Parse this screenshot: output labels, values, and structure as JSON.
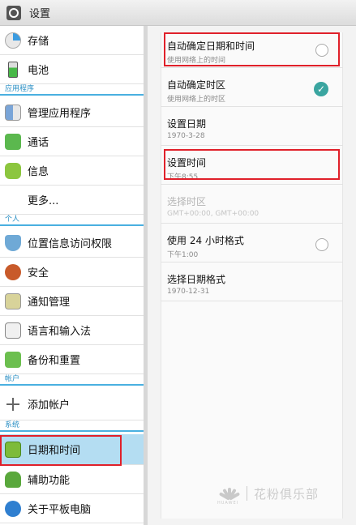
{
  "title": "设置",
  "sidebar": {
    "items": [
      {
        "label": "存储",
        "icon": "storage-pie-icon"
      },
      {
        "label": "电池",
        "icon": "battery-icon"
      },
      {
        "label": "管理应用程序",
        "icon": "apps-grid-icon"
      },
      {
        "label": "通话",
        "icon": "phone-icon"
      },
      {
        "label": "信息",
        "icon": "message-icon"
      },
      {
        "label": "更多...",
        "icon": ""
      },
      {
        "label": "位置信息访问权限",
        "icon": "location-icon"
      },
      {
        "label": "安全",
        "icon": "lock-icon"
      },
      {
        "label": "通知管理",
        "icon": "info-icon"
      },
      {
        "label": "语言和输入法",
        "icon": "keyboard-icon"
      },
      {
        "label": "备份和重置",
        "icon": "backup-icon"
      },
      {
        "label": "添加帐户",
        "icon": "plus-icon"
      },
      {
        "label": "日期和时间",
        "icon": "clock-icon"
      },
      {
        "label": "辅助功能",
        "icon": "hand-icon"
      },
      {
        "label": "关于平板电脑",
        "icon": "about-icon"
      }
    ],
    "headers": [
      "应用程序",
      "个人",
      "帐户",
      "系统"
    ],
    "selected": "日期和时间"
  },
  "detail": {
    "items": [
      {
        "title": "自动确定日期和时间",
        "summary": "使用网络上的时间",
        "control": "radio-off"
      },
      {
        "title": "自动确定时区",
        "summary": "使用网络上的时区",
        "control": "checked"
      },
      {
        "title": "设置日期",
        "summary": "1970-3-28",
        "control": "none"
      },
      {
        "title": "设置时间",
        "summary": "下午8:55",
        "control": "none"
      },
      {
        "title": "选择时区",
        "summary": "GMT+00:00, GMT+00:00",
        "control": "none",
        "disabled": true
      },
      {
        "title": "使用 24 小时格式",
        "summary": "下午1:00",
        "control": "radio-off"
      },
      {
        "title": "选择日期格式",
        "summary": "1970-12-31",
        "control": "none"
      }
    ]
  },
  "watermark": {
    "brand": "HUAWEI",
    "text": "花粉俱乐部"
  },
  "colors": {
    "accent": "#4ab0e0",
    "selected_bg": "#b4ddf2",
    "highlight": "#e0202a",
    "check": "#3aa5a0"
  }
}
